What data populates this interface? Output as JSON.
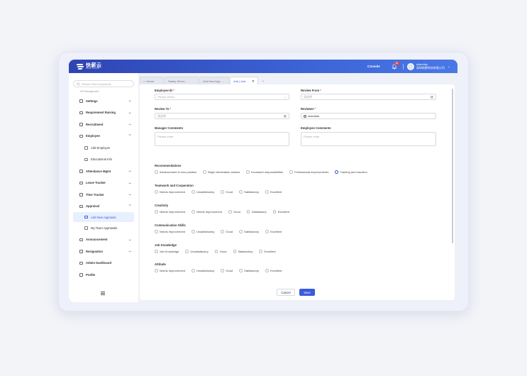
{
  "brand": {
    "name": "快薪云",
    "tagline": "SAAS CLOUD"
  },
  "header": {
    "console_label": "Console",
    "notification_count": "18",
    "user_name": "shandian",
    "user_company": "深圳快薪科技有限公司"
  },
  "sidebar": {
    "search_placeholder": "Please Enter Keywords",
    "clipped_item": "HR Management",
    "items": [
      {
        "label": "Settings",
        "chevron": "⌄"
      },
      {
        "label": "Requirement Raising",
        "chevron": "⌄"
      },
      {
        "label": "Recruitment",
        "chevron": "⌄"
      },
      {
        "label": "Employee",
        "chevron": "⌃"
      },
      {
        "label": "Add Employee",
        "chevron": ""
      },
      {
        "label": "Educational Info",
        "chevron": ""
      },
      {
        "label": "Attendance Mgmt",
        "chevron": "⌄"
      },
      {
        "label": "Leave Tracker",
        "chevron": "⌄"
      },
      {
        "label": "Time Tracker",
        "chevron": "⌄"
      },
      {
        "label": "Appraisal",
        "chevron": "⌃"
      },
      {
        "label": "Add New Appraisal",
        "chevron": ""
      },
      {
        "label": "My Team Appraisals",
        "chevron": ""
      },
      {
        "label": "Announcement",
        "chevron": "⌄"
      },
      {
        "label": "Resignation",
        "chevron": "⌄"
      },
      {
        "label": "Admin Dashboard",
        "chevron": ""
      },
      {
        "label": "Profile",
        "chevron": ""
      }
    ]
  },
  "tabs": [
    {
      "label": "Home"
    },
    {
      "label": "Salary Struct..."
    },
    {
      "label": "Add New App..."
    },
    {
      "label": "Add | Add ...",
      "close": "✕"
    }
  ],
  "tabs_more": "⌄",
  "form": {
    "employee_id": {
      "label": "Employee ID",
      "placeholder": "Please select",
      "suffix": "⌄"
    },
    "review_from": {
      "label": "Review From",
      "placeholder": "请选择",
      "suffix": "▦"
    },
    "review_to": {
      "label": "Review To",
      "placeholder": "请选择",
      "suffix": "▦"
    },
    "reviewer": {
      "label": "Reviewer",
      "value": "shandian"
    },
    "manager_comments": {
      "label": "Manager Comments",
      "placeholder": "Please enter"
    },
    "employee_comments": {
      "label": "Employee Comments",
      "placeholder": "Please enter"
    },
    "required_mark": "*"
  },
  "sections": [
    {
      "title": "Recommendations",
      "options": [
        "Advancement to new position",
        "Begin termination actions",
        "Increased responsibilities",
        "Professional improvements",
        "Training and eduction"
      ],
      "selected": 4
    },
    {
      "title": "Teamwork and Cooperation",
      "options": [
        "Needs Improvement",
        "Unsatisfactory",
        "Good",
        "Satisfactory",
        "Excellent"
      ],
      "selected": -1
    },
    {
      "title": "Creativity",
      "options": [
        "Needs Improvement",
        "Needs Improvement",
        "Good",
        "Satisfactory",
        "Excellent"
      ],
      "selected": -1
    },
    {
      "title": "Communication Skills",
      "options": [
        "Needs Improvement",
        "Unsatisfactory",
        "Good",
        "Satisfactory",
        "Excellent"
      ],
      "selected": -1
    },
    {
      "title": "Job Knowledge",
      "options": [
        "Job Knowledge",
        "Unsatisfactory",
        "Good",
        "Satisfactory",
        "Excellent"
      ],
      "selected": -1
    },
    {
      "title": "Attitude",
      "options": [
        "Needs Improvement",
        "Unsatisfactory",
        "Good",
        "Satisfactory",
        "Excellent"
      ],
      "selected": -1
    }
  ],
  "buttons": {
    "cancel": "Cancel",
    "save": "Save"
  },
  "colors": {
    "primary": "#3b5bdb",
    "header_gradient": "#2f44b3",
    "danger": "#e54545"
  }
}
